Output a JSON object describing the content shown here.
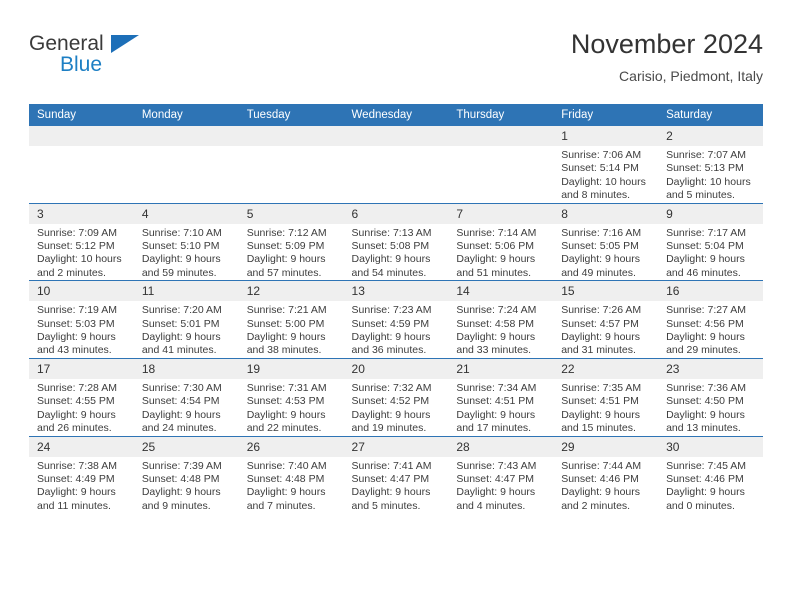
{
  "brand": {
    "name_part1": "General",
    "name_part2": "Blue",
    "triangle_color": "#1d6fb8",
    "blue_text_color": "#1d7fc4"
  },
  "header": {
    "title": "November 2024",
    "subtitle": "Carisio, Piedmont, Italy",
    "accent_color": "#2e74b5"
  },
  "calendar": {
    "weekday_headers": [
      "Sunday",
      "Monday",
      "Tuesday",
      "Wednesday",
      "Thursday",
      "Friday",
      "Saturday"
    ],
    "labels": {
      "sunrise": "Sunrise:",
      "sunset": "Sunset:",
      "daylight": "Daylight:"
    },
    "weeks": [
      [
        {
          "day": "",
          "empty": true
        },
        {
          "day": "",
          "empty": true
        },
        {
          "day": "",
          "empty": true
        },
        {
          "day": "",
          "empty": true
        },
        {
          "day": "",
          "empty": true
        },
        {
          "day": "1",
          "sunrise": "Sunrise: 7:06 AM",
          "sunset": "Sunset: 5:14 PM",
          "daylight": "Daylight: 10 hours and 8 minutes."
        },
        {
          "day": "2",
          "sunrise": "Sunrise: 7:07 AM",
          "sunset": "Sunset: 5:13 PM",
          "daylight": "Daylight: 10 hours and 5 minutes."
        }
      ],
      [
        {
          "day": "3",
          "sunrise": "Sunrise: 7:09 AM",
          "sunset": "Sunset: 5:12 PM",
          "daylight": "Daylight: 10 hours and 2 minutes."
        },
        {
          "day": "4",
          "sunrise": "Sunrise: 7:10 AM",
          "sunset": "Sunset: 5:10 PM",
          "daylight": "Daylight: 9 hours and 59 minutes."
        },
        {
          "day": "5",
          "sunrise": "Sunrise: 7:12 AM",
          "sunset": "Sunset: 5:09 PM",
          "daylight": "Daylight: 9 hours and 57 minutes."
        },
        {
          "day": "6",
          "sunrise": "Sunrise: 7:13 AM",
          "sunset": "Sunset: 5:08 PM",
          "daylight": "Daylight: 9 hours and 54 minutes."
        },
        {
          "day": "7",
          "sunrise": "Sunrise: 7:14 AM",
          "sunset": "Sunset: 5:06 PM",
          "daylight": "Daylight: 9 hours and 51 minutes."
        },
        {
          "day": "8",
          "sunrise": "Sunrise: 7:16 AM",
          "sunset": "Sunset: 5:05 PM",
          "daylight": "Daylight: 9 hours and 49 minutes."
        },
        {
          "day": "9",
          "sunrise": "Sunrise: 7:17 AM",
          "sunset": "Sunset: 5:04 PM",
          "daylight": "Daylight: 9 hours and 46 minutes."
        }
      ],
      [
        {
          "day": "10",
          "sunrise": "Sunrise: 7:19 AM",
          "sunset": "Sunset: 5:03 PM",
          "daylight": "Daylight: 9 hours and 43 minutes."
        },
        {
          "day": "11",
          "sunrise": "Sunrise: 7:20 AM",
          "sunset": "Sunset: 5:01 PM",
          "daylight": "Daylight: 9 hours and 41 minutes."
        },
        {
          "day": "12",
          "sunrise": "Sunrise: 7:21 AM",
          "sunset": "Sunset: 5:00 PM",
          "daylight": "Daylight: 9 hours and 38 minutes."
        },
        {
          "day": "13",
          "sunrise": "Sunrise: 7:23 AM",
          "sunset": "Sunset: 4:59 PM",
          "daylight": "Daylight: 9 hours and 36 minutes."
        },
        {
          "day": "14",
          "sunrise": "Sunrise: 7:24 AM",
          "sunset": "Sunset: 4:58 PM",
          "daylight": "Daylight: 9 hours and 33 minutes."
        },
        {
          "day": "15",
          "sunrise": "Sunrise: 7:26 AM",
          "sunset": "Sunset: 4:57 PM",
          "daylight": "Daylight: 9 hours and 31 minutes."
        },
        {
          "day": "16",
          "sunrise": "Sunrise: 7:27 AM",
          "sunset": "Sunset: 4:56 PM",
          "daylight": "Daylight: 9 hours and 29 minutes."
        }
      ],
      [
        {
          "day": "17",
          "sunrise": "Sunrise: 7:28 AM",
          "sunset": "Sunset: 4:55 PM",
          "daylight": "Daylight: 9 hours and 26 minutes."
        },
        {
          "day": "18",
          "sunrise": "Sunrise: 7:30 AM",
          "sunset": "Sunset: 4:54 PM",
          "daylight": "Daylight: 9 hours and 24 minutes."
        },
        {
          "day": "19",
          "sunrise": "Sunrise: 7:31 AM",
          "sunset": "Sunset: 4:53 PM",
          "daylight": "Daylight: 9 hours and 22 minutes."
        },
        {
          "day": "20",
          "sunrise": "Sunrise: 7:32 AM",
          "sunset": "Sunset: 4:52 PM",
          "daylight": "Daylight: 9 hours and 19 minutes."
        },
        {
          "day": "21",
          "sunrise": "Sunrise: 7:34 AM",
          "sunset": "Sunset: 4:51 PM",
          "daylight": "Daylight: 9 hours and 17 minutes."
        },
        {
          "day": "22",
          "sunrise": "Sunrise: 7:35 AM",
          "sunset": "Sunset: 4:51 PM",
          "daylight": "Daylight: 9 hours and 15 minutes."
        },
        {
          "day": "23",
          "sunrise": "Sunrise: 7:36 AM",
          "sunset": "Sunset: 4:50 PM",
          "daylight": "Daylight: 9 hours and 13 minutes."
        }
      ],
      [
        {
          "day": "24",
          "sunrise": "Sunrise: 7:38 AM",
          "sunset": "Sunset: 4:49 PM",
          "daylight": "Daylight: 9 hours and 11 minutes."
        },
        {
          "day": "25",
          "sunrise": "Sunrise: 7:39 AM",
          "sunset": "Sunset: 4:48 PM",
          "daylight": "Daylight: 9 hours and 9 minutes."
        },
        {
          "day": "26",
          "sunrise": "Sunrise: 7:40 AM",
          "sunset": "Sunset: 4:48 PM",
          "daylight": "Daylight: 9 hours and 7 minutes."
        },
        {
          "day": "27",
          "sunrise": "Sunrise: 7:41 AM",
          "sunset": "Sunset: 4:47 PM",
          "daylight": "Daylight: 9 hours and 5 minutes."
        },
        {
          "day": "28",
          "sunrise": "Sunrise: 7:43 AM",
          "sunset": "Sunset: 4:47 PM",
          "daylight": "Daylight: 9 hours and 4 minutes."
        },
        {
          "day": "29",
          "sunrise": "Sunrise: 7:44 AM",
          "sunset": "Sunset: 4:46 PM",
          "daylight": "Daylight: 9 hours and 2 minutes."
        },
        {
          "day": "30",
          "sunrise": "Sunrise: 7:45 AM",
          "sunset": "Sunset: 4:46 PM",
          "daylight": "Daylight: 9 hours and 0 minutes."
        }
      ]
    ]
  }
}
